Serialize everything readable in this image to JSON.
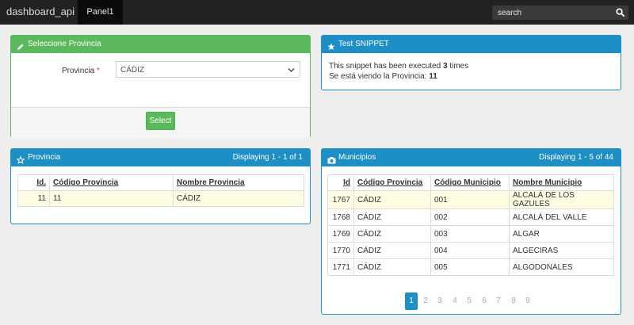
{
  "navbar": {
    "brand": "dashboard_api",
    "tab": "Panel1",
    "search_placeholder": "search"
  },
  "select_panel": {
    "title": "Seleccione Provincia",
    "field_label": "Provincia",
    "required_mark": "*",
    "selected_value": "CÁDIZ",
    "button_label": "Select"
  },
  "snippet_panel": {
    "title": "Test SNIPPET",
    "line1_prefix": "This snippet has been executed ",
    "line1_count": "3",
    "line1_suffix": " times",
    "line2_prefix": "Se está viendo la Provincia: ",
    "line2_value": "11"
  },
  "provincia_panel": {
    "title": "Provincia",
    "displaying": "Displaying 1 - 1 of 1",
    "columns": [
      "Id.",
      "Código Provincia",
      "Nombre Provincia"
    ],
    "rows": [
      [
        "11",
        "11",
        "CÁDIZ"
      ]
    ]
  },
  "municipios_panel": {
    "title": "Municipios",
    "displaying": "Displaying 1 - 5 of 44",
    "columns": [
      "Id",
      "Código Provincia",
      "Código Municipio",
      "Nombre Municipio"
    ],
    "rows": [
      [
        "1767",
        "CÁDIZ",
        "001",
        "ALCALÁ DE LOS GAZULES"
      ],
      [
        "1768",
        "CÁDIZ",
        "002",
        "ALCALÁ DEL VALLE"
      ],
      [
        "1769",
        "CÁDIZ",
        "003",
        "ALGAR"
      ],
      [
        "1770",
        "CÁDIZ",
        "004",
        "ALGECIRAS"
      ],
      [
        "1771",
        "CÁDIZ",
        "005",
        "ALGODONALES"
      ]
    ],
    "pages": [
      "1",
      "2",
      "3",
      "4",
      "5",
      "6",
      "7",
      "8",
      "9"
    ],
    "current_page": "1"
  },
  "colors": {
    "success": "#5cb85c",
    "primary": "#1d8fc4",
    "navbar": "#222222",
    "highlight_row": "#fdfbe1"
  },
  "icons": {
    "select_panel": "pencil-icon",
    "snippet_panel": "star-icon",
    "provincia_panel": "star-outline-icon",
    "municipios_panel": "camera-icon",
    "search": "search-icon",
    "select_arrow": "chevron-down-icon"
  }
}
